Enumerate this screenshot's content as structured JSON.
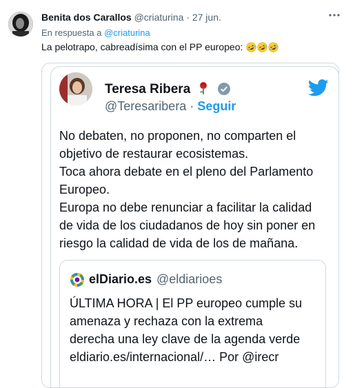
{
  "reply_tweet": {
    "author_name": "Benita dos Carallos",
    "handle": "@criaturina",
    "separator": "·",
    "date": "27 jun.",
    "reply_prefix": "En respuesta a",
    "reply_to": "@criaturina",
    "text": "La pelotrapo, cabreadísima con el PP europeo:",
    "emoji_count": 3
  },
  "embedded_tweet": {
    "author_name": "Teresa Ribera",
    "handle": "@Teresaribera",
    "separator": "·",
    "follow_label": "Seguir",
    "body_lines": [
      "No debaten, no proponen, no comparten el",
      "objetivo de restaurar ecosistemas.",
      "Toca ahora debate en el pleno del Parlamento",
      "Europeo.",
      "Europa no debe renunciar a facilitar la calidad",
      "de vida de los ciudadanos de hoy sin poner en",
      "riesgo la calidad de vida de los de mañana."
    ],
    "quoted": {
      "author_name": "elDiario.es",
      "handle": "@eldiarioes",
      "lines": [
        "ÚLTIMA HORA | El PP europeo cumple su",
        "amenaza y rechaza con la extrema",
        "derecha una ley clave de la agenda verde",
        "eldiario.es/internacional/… Por @irecr"
      ]
    }
  },
  "icons": [
    "more-icon",
    "rose-icon",
    "verified-icon",
    "twitter-bird-icon",
    "eldiario-logo-icon",
    "rofl-emoji-icon"
  ],
  "colors": {
    "link": "#1d9bf0",
    "muted": "#536471",
    "border": "#cfd9de",
    "text": "#0f1419"
  }
}
